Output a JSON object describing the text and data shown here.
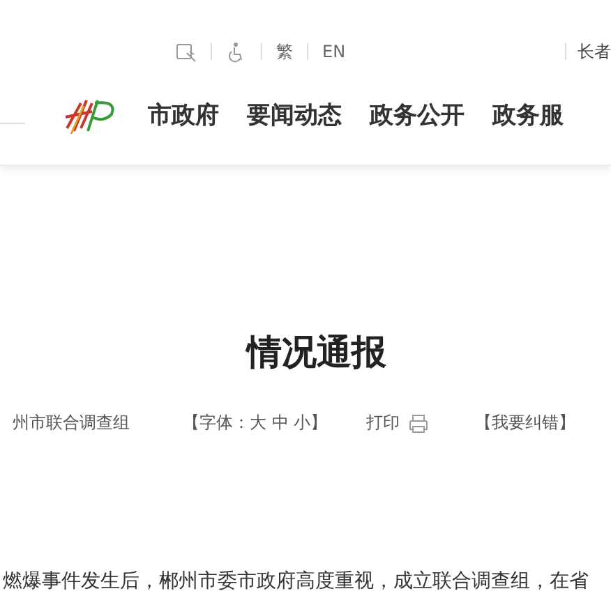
{
  "header": {
    "tools": [
      {
        "kind": "reader"
      },
      {
        "kind": "accessibility"
      },
      {
        "kind": "text",
        "label": "繁"
      },
      {
        "kind": "text",
        "label": "EN"
      }
    ],
    "elder_link": "长者",
    "nav": [
      "市政府",
      "要闻动态",
      "政务公开",
      "政务服"
    ]
  },
  "article": {
    "title": "情况通报",
    "source": "州市联合调查组",
    "font_size_label": "【字体：大 中 小】",
    "print_label": "打印",
    "correction_link": "【我要纠错】",
    "body_line": "燃爆事件发生后，郴州市委市政府高度重视，成立联合调查组，在省"
  }
}
